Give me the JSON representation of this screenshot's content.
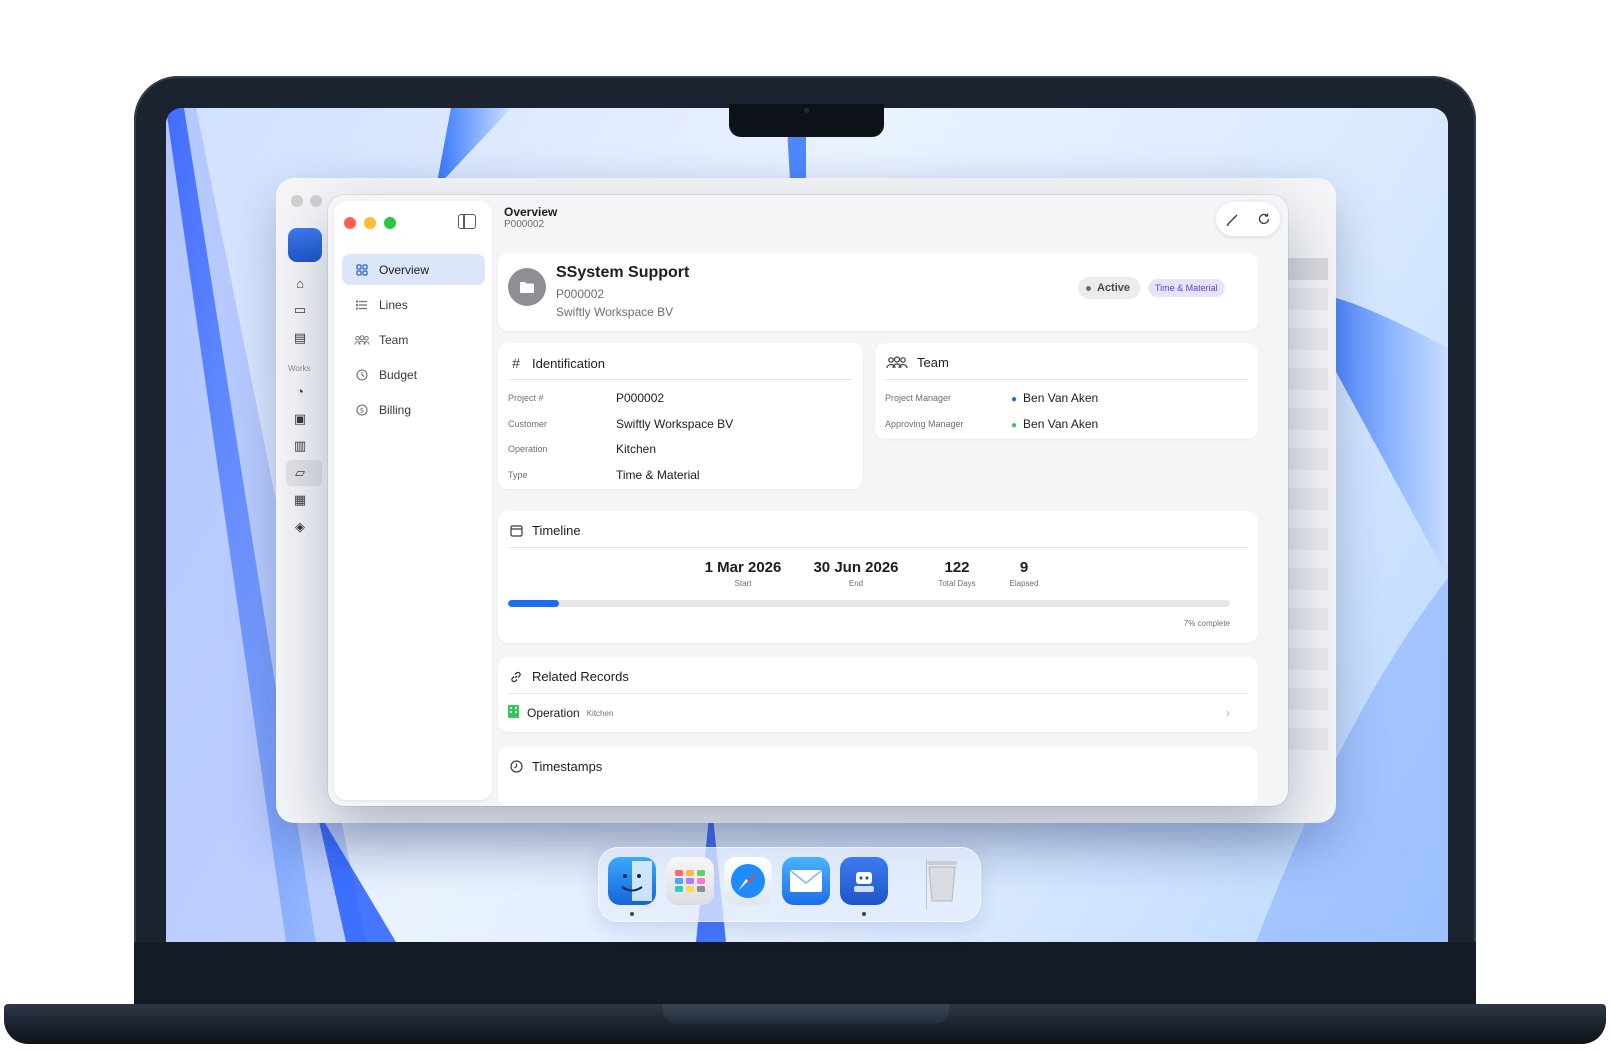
{
  "window": {
    "title": "Overview",
    "subtitle": "P000002"
  },
  "sidebar": {
    "items": [
      {
        "label": "Overview",
        "icon": "grid-icon",
        "active": true
      },
      {
        "label": "Lines",
        "icon": "list-icon",
        "active": false
      },
      {
        "label": "Team",
        "icon": "people-icon",
        "active": false
      },
      {
        "label": "Budget",
        "icon": "budget-icon",
        "active": false
      },
      {
        "label": "Billing",
        "icon": "dollar-icon",
        "active": false
      }
    ]
  },
  "project": {
    "name": "SSystem Support",
    "number": "P000002",
    "customer": "Swiftly Workspace BV",
    "status": "Active",
    "type_badge": "Time & Material"
  },
  "identification": {
    "title": "Identification",
    "rows": [
      {
        "label": "Project #",
        "value": "P000002"
      },
      {
        "label": "Customer",
        "value": "Swiftly Workspace BV"
      },
      {
        "label": "Operation",
        "value": "Kitchen"
      },
      {
        "label": "Type",
        "value": "Time & Material"
      }
    ]
  },
  "team": {
    "title": "Team",
    "rows": [
      {
        "label": "Project Manager",
        "value": "Ben Van Aken",
        "icon": "person-icon"
      },
      {
        "label": "Approving Manager",
        "value": "Ben Van Aken",
        "icon": "person-check-icon"
      }
    ]
  },
  "timeline": {
    "title": "Timeline",
    "stats": [
      {
        "value": "1 Mar 2026",
        "caption": "Start"
      },
      {
        "value": "30 Jun 2026",
        "caption": "End"
      },
      {
        "value": "122",
        "caption": "Total Days"
      },
      {
        "value": "9",
        "caption": "Elapsed"
      }
    ],
    "progress": 0.07,
    "progress_label": "7% complete"
  },
  "related": {
    "title": "Related Records",
    "rows": [
      {
        "label": "Operation",
        "sub": "Kitchen"
      }
    ]
  },
  "timestamps": {
    "title": "Timestamps"
  },
  "background_window": {
    "section_label": "Works"
  },
  "colors": {
    "accent": "#1a6ef5",
    "active_nav": "#dbe6f9",
    "badge_type_bg": "#e8e2ff",
    "badge_type_fg": "#5b45c9",
    "sheet_green": "#34c759"
  },
  "dock": {
    "apps": [
      "finder-icon",
      "launchpad-icon",
      "safari-icon",
      "mail-icon",
      "workspace-app-icon",
      "trash-icon"
    ]
  }
}
